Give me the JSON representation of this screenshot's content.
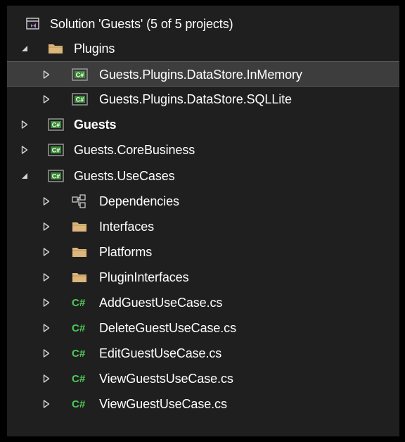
{
  "solution": {
    "label": "Solution 'Guests' (5 of 5 projects)",
    "icon": "solution-icon"
  },
  "tree": [
    {
      "id": "plugins",
      "label": "Plugins",
      "kind": "folder",
      "expanded": true,
      "level": 1
    },
    {
      "id": "inmemory",
      "label": "Guests.Plugins.DataStore.InMemory",
      "kind": "project",
      "expanded": false,
      "level": 2,
      "selected": true
    },
    {
      "id": "sqllite",
      "label": "Guests.Plugins.DataStore.SQLLite",
      "kind": "project",
      "expanded": false,
      "level": 2
    },
    {
      "id": "guests",
      "label": "Guests",
      "kind": "project",
      "expanded": false,
      "level": 1,
      "bold": true
    },
    {
      "id": "corebusiness",
      "label": "Guests.CoreBusiness",
      "kind": "project",
      "expanded": false,
      "level": 1
    },
    {
      "id": "usecases",
      "label": "Guests.UseCases",
      "kind": "project",
      "expanded": true,
      "level": 1
    },
    {
      "id": "dependencies",
      "label": "Dependencies",
      "kind": "dependencies",
      "expanded": false,
      "level": 2
    },
    {
      "id": "interfaces",
      "label": "Interfaces",
      "kind": "folder",
      "expanded": false,
      "level": 2
    },
    {
      "id": "platforms",
      "label": "Platforms",
      "kind": "folder",
      "expanded": false,
      "level": 2
    },
    {
      "id": "plugininterfaces",
      "label": "PluginInterfaces",
      "kind": "folder",
      "expanded": false,
      "level": 2
    },
    {
      "id": "addguest",
      "label": "AddGuestUseCase.cs",
      "kind": "csfile",
      "expanded": false,
      "level": 2
    },
    {
      "id": "deleteguest",
      "label": "DeleteGuestUseCase.cs",
      "kind": "csfile",
      "expanded": false,
      "level": 2
    },
    {
      "id": "editguest",
      "label": "EditGuestUseCase.cs",
      "kind": "csfile",
      "expanded": false,
      "level": 2
    },
    {
      "id": "viewguests",
      "label": "ViewGuestsUseCase.cs",
      "kind": "csfile",
      "expanded": false,
      "level": 2
    },
    {
      "id": "viewguest",
      "label": "ViewGuestUseCase.cs",
      "kind": "csfile",
      "expanded": false,
      "level": 2
    }
  ],
  "icon_glyphs": {
    "project_badge": "C#",
    "csfile": "C#"
  },
  "colors": {
    "background": "#1f1f1f",
    "selected_row": "#3d3d3d",
    "text": "#ffffff",
    "expander": "#d4d4d4",
    "folder": "#dcb67a",
    "project_badge": "#388a34",
    "csfile": "#4ec95a",
    "solution": "#b180d7"
  }
}
